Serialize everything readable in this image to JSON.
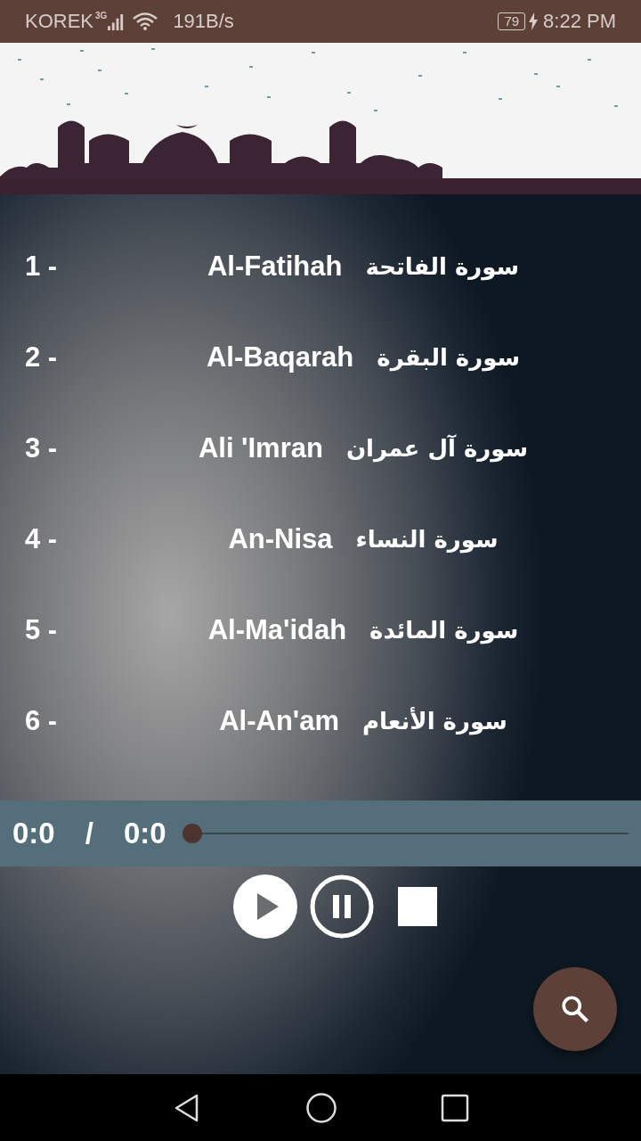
{
  "status_bar": {
    "carrier": "KOREK",
    "network": "3G",
    "speed": "191B/s",
    "battery": "79",
    "time": "8:22 PM"
  },
  "surahs": [
    {
      "number": "1 -",
      "name": "Al-Fatihah",
      "arabic": "سورة الفاتحة"
    },
    {
      "number": "2 -",
      "name": "Al-Baqarah",
      "arabic": "سورة البقرة"
    },
    {
      "number": "3 -",
      "name": "Ali 'Imran",
      "arabic": "سورة آل عمران"
    },
    {
      "number": "4 -",
      "name": "An-Nisa",
      "arabic": "سورة النساء"
    },
    {
      "number": "5 -",
      "name": "Al-Ma'idah",
      "arabic": "سورة المائدة"
    },
    {
      "number": "6 -",
      "name": "Al-An'am",
      "arabic": "سورة الأنعام"
    }
  ],
  "player": {
    "elapsed": "0:0",
    "separator": "/",
    "duration": "0:0",
    "level": 0
  }
}
